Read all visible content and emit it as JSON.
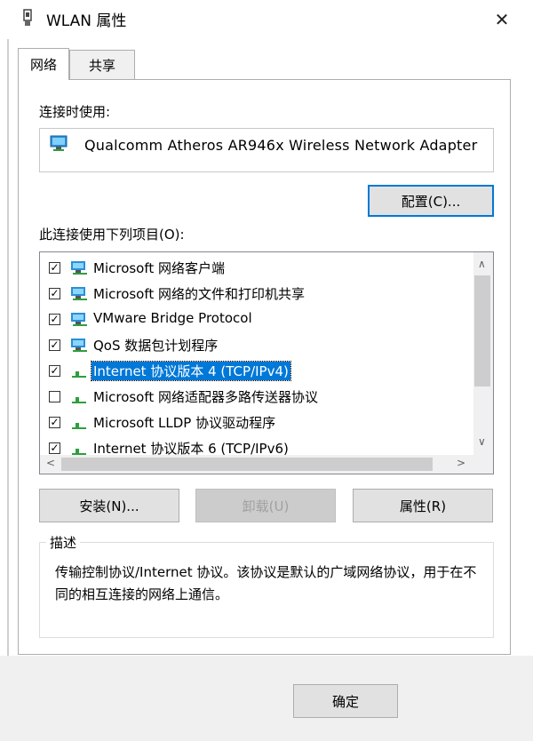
{
  "window": {
    "title": "WLAN 属性",
    "close_glyph": "✕"
  },
  "tabs": [
    {
      "label": "网络"
    },
    {
      "label": "共享"
    }
  ],
  "connect_using": {
    "label": "连接时使用:",
    "adapter": "Qualcomm Atheros AR946x Wireless Network Adapter",
    "configure_button": "配置(C)..."
  },
  "items_section": {
    "label": "此连接使用下列项目(O):",
    "items": [
      {
        "label": "Microsoft 网络客户端",
        "checked": true,
        "icon": "network-client-icon"
      },
      {
        "label": "Microsoft 网络的文件和打印机共享",
        "checked": true,
        "icon": "network-service-icon"
      },
      {
        "label": "VMware Bridge Protocol",
        "checked": true,
        "icon": "network-service-icon"
      },
      {
        "label": "QoS 数据包计划程序",
        "checked": true,
        "icon": "network-service-icon"
      },
      {
        "label": "Internet 协议版本 4 (TCP/IPv4)",
        "checked": true,
        "icon": "protocol-icon",
        "selected": true
      },
      {
        "label": "Microsoft 网络适配器多路传送器协议",
        "checked": false,
        "icon": "protocol-icon"
      },
      {
        "label": "Microsoft LLDP 协议驱动程序",
        "checked": true,
        "icon": "protocol-icon"
      },
      {
        "label": "Internet 协议版本 6 (TCP/IPv6)",
        "checked": true,
        "icon": "protocol-icon"
      }
    ]
  },
  "buttons": {
    "install": "安装(N)...",
    "uninstall": "卸载(U)",
    "properties": "属性(R)"
  },
  "description": {
    "title": "描述",
    "text": "传输控制协议/Internet 协议。该协议是默认的广域网络协议，用于在不同的相互连接的网络上通信。"
  },
  "footer": {
    "ok_button": "确定"
  },
  "colors": {
    "accent": "#0078d7",
    "panel_border": "#adadad",
    "button_bg": "#e1e1e1"
  }
}
